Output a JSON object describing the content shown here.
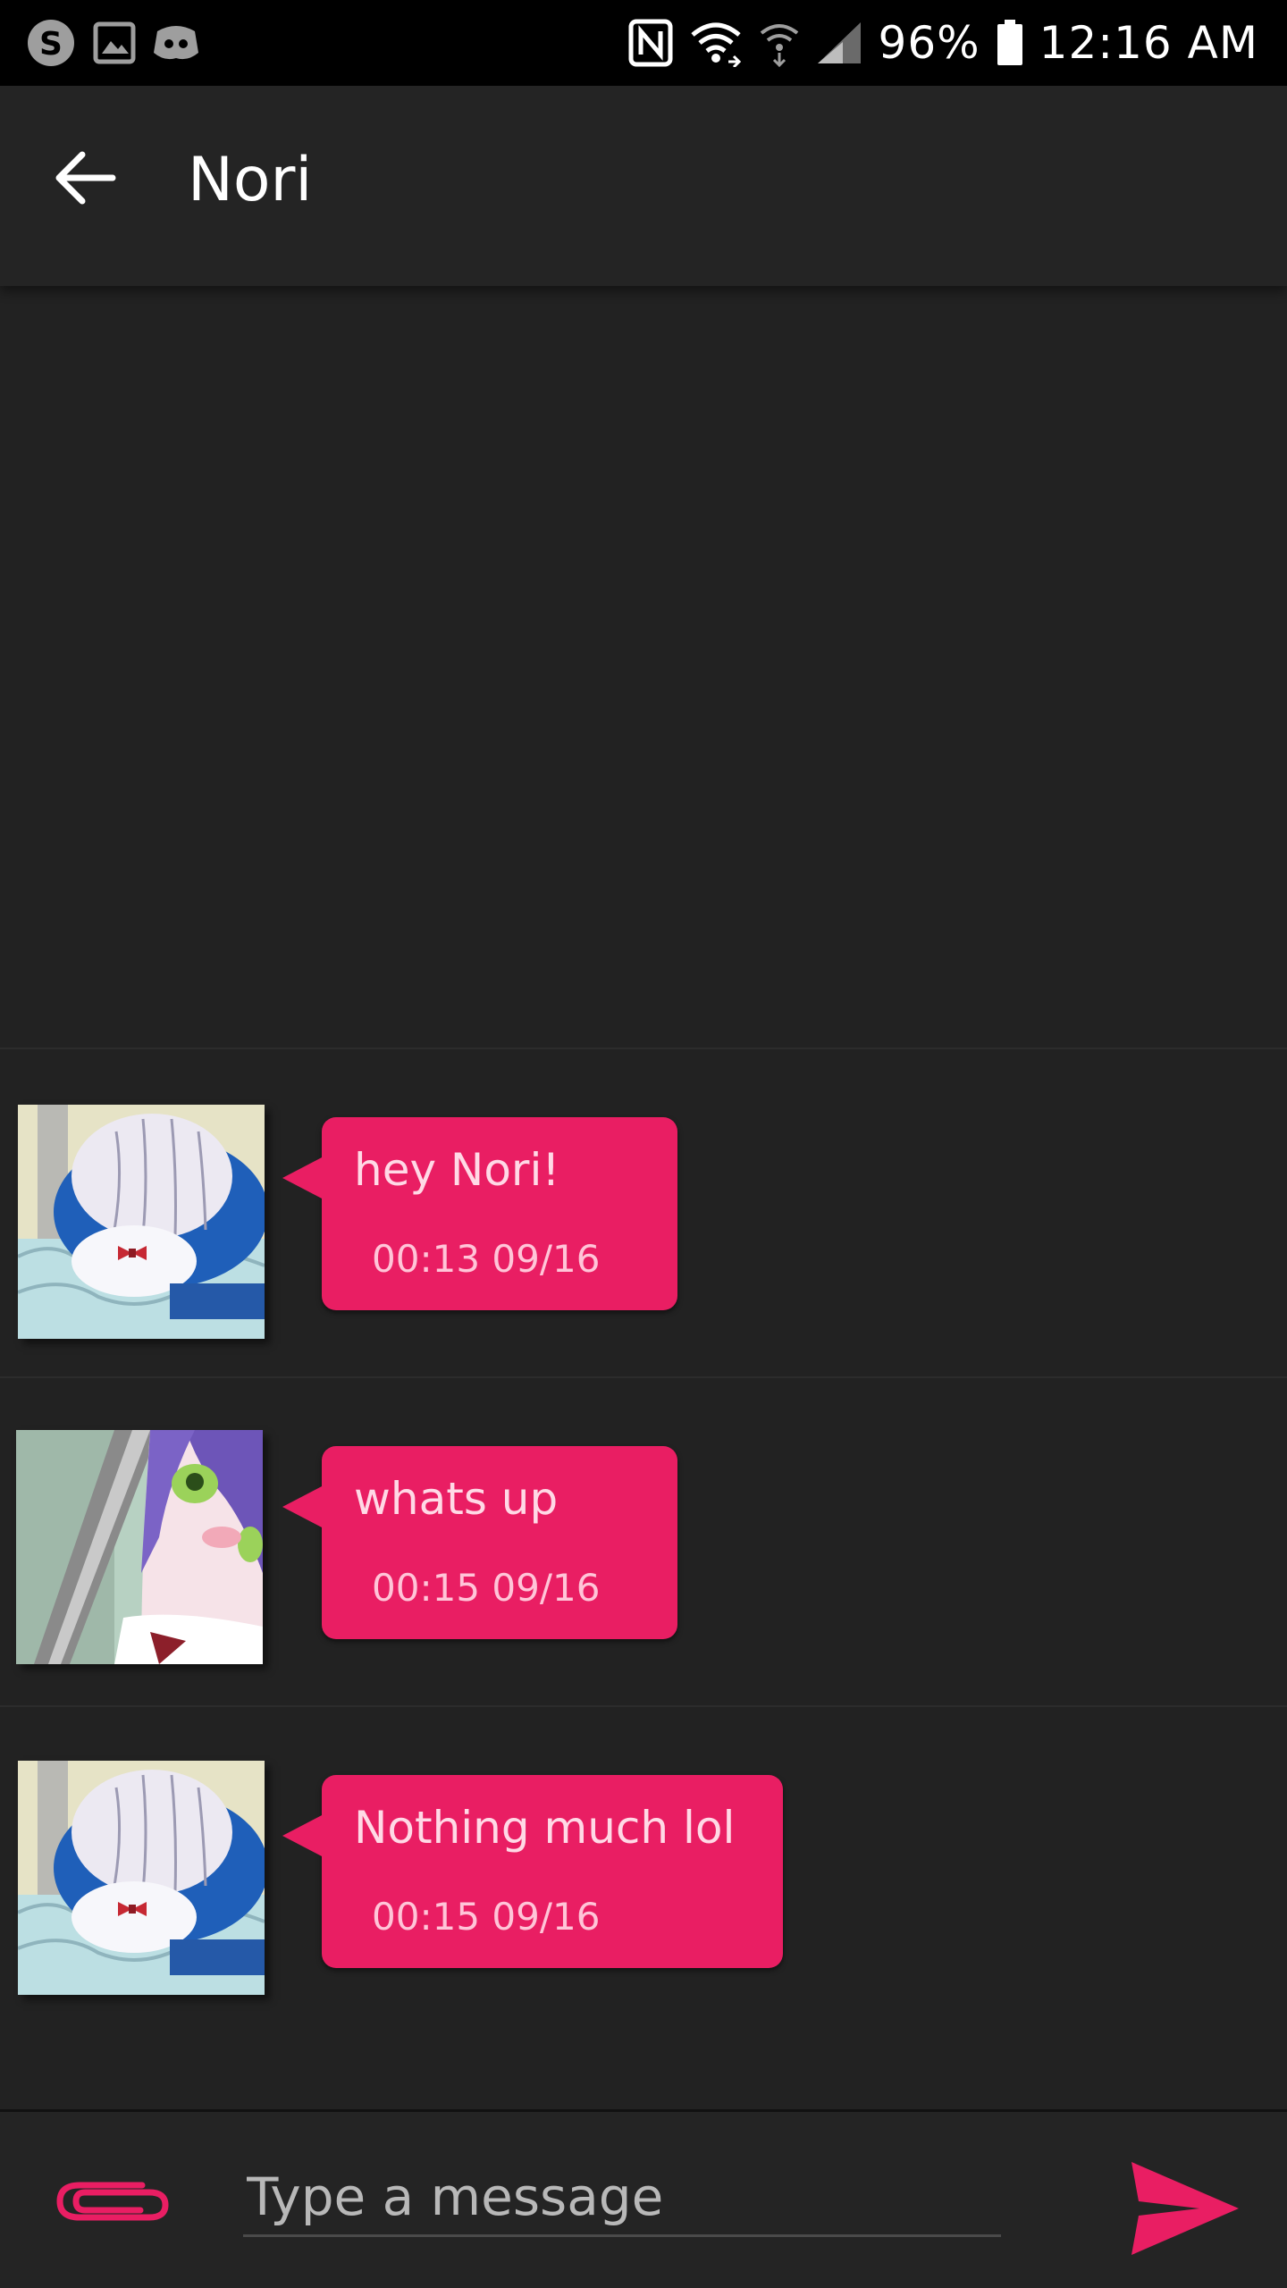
{
  "status_bar": {
    "icons_left": [
      "skype-icon",
      "gallery-icon",
      "discord-icon"
    ],
    "icons_right": [
      "nfc-icon",
      "wifi-icon",
      "wifi-calling-icon",
      "signal-icon",
      "battery-icon"
    ],
    "battery_percent": "96%",
    "time": "12:16 AM"
  },
  "header": {
    "back_icon": "arrow-left-icon",
    "title": "Nori"
  },
  "messages": [
    {
      "text": "hey Nori!",
      "time": "00:13 09/16",
      "avatar": "avatar-whale-hat"
    },
    {
      "text": "whats up",
      "time": "00:15 09/16",
      "avatar": "avatar-purple-hair"
    },
    {
      "text": "Nothing much lol",
      "time": "00:15 09/16",
      "avatar": "avatar-whale-hat"
    }
  ],
  "composer": {
    "placeholder": "Type a message",
    "value": "",
    "attach_icon": "paperclip-icon",
    "send_icon": "send-icon"
  },
  "colors": {
    "accent": "#e91e63",
    "background": "#222222",
    "status_bar": "#000000",
    "app_bar": "#242424"
  }
}
